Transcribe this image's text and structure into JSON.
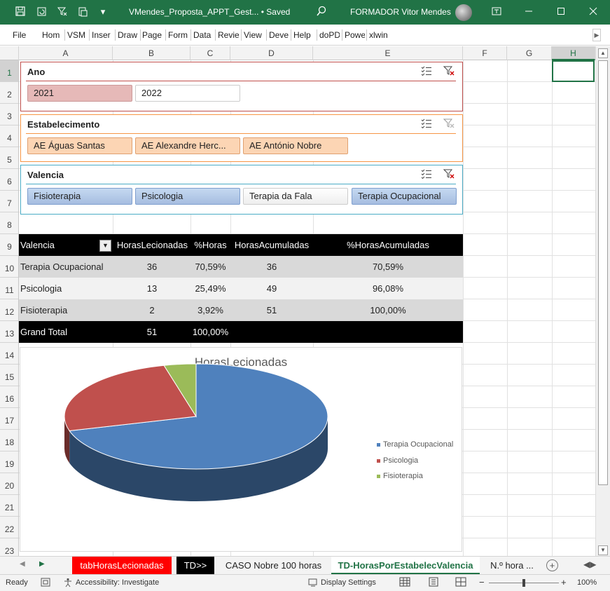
{
  "titlebar": {
    "doc_title": "VMendes_Proposta_APPT_Gest... • Saved",
    "user": "FORMADOR Vitor Mendes",
    "qat_more": "▾"
  },
  "ribbon": {
    "tabs": [
      "File",
      "Hom",
      "VSM",
      "Inser",
      "Draw",
      "Page",
      "Form",
      "Data",
      "Revie",
      "View",
      "Deve",
      "Help",
      "doPD",
      "Powe",
      "xlwin"
    ]
  },
  "columns": [
    "A",
    "B",
    "C",
    "D",
    "E",
    "F",
    "G",
    "H"
  ],
  "rows": [
    "1",
    "2",
    "3",
    "4",
    "5",
    "6",
    "7",
    "8",
    "9",
    "10",
    "11",
    "12",
    "13",
    "14",
    "15",
    "16",
    "17",
    "18",
    "19",
    "20",
    "21",
    "22",
    "23"
  ],
  "slicers": {
    "ano": {
      "title": "Ano",
      "items": [
        {
          "label": "2021",
          "selected": true
        },
        {
          "label": "2022",
          "selected": false
        }
      ]
    },
    "estabelecimento": {
      "title": "Estabelecimento",
      "items": [
        {
          "label": "AE Águas Santas",
          "selected": true
        },
        {
          "label": "AE Alexandre Herc...",
          "selected": true
        },
        {
          "label": "AE António Nobre",
          "selected": true
        }
      ]
    },
    "valencia": {
      "title": "Valencia",
      "items": [
        {
          "label": "Fisioterapia",
          "selected": true
        },
        {
          "label": "Psicologia",
          "selected": true
        },
        {
          "label": "Terapia da Fala",
          "selected": false
        },
        {
          "label": "Terapia Ocupacional",
          "selected": true
        }
      ]
    }
  },
  "pivot": {
    "headers": [
      "Valencia",
      "HorasLecionadas",
      "%Horas",
      "HorasAcumuladas",
      "%HorasAcumuladas"
    ],
    "rows": [
      [
        "Terapia Ocupacional",
        "36",
        "70,59%",
        "36",
        "70,59%"
      ],
      [
        "Psicologia",
        "13",
        "25,49%",
        "49",
        "96,08%"
      ],
      [
        "Fisioterapia",
        "2",
        "3,92%",
        "51",
        "100,00%"
      ]
    ],
    "total": [
      "Grand Total",
      "51",
      "100,00%",
      "",
      ""
    ]
  },
  "chart_data": {
    "type": "pie",
    "title": "HorasLecionadas",
    "categories": [
      "Terapia Ocupacional",
      "Psicologia",
      "Fisioterapia"
    ],
    "values": [
      36,
      13,
      2
    ],
    "colors": [
      "#4F81BD",
      "#C0504D",
      "#9BBB59"
    ],
    "legend": "right",
    "style": "3d"
  },
  "sheet_tabs": [
    {
      "label": "tabHorasLecionadas",
      "bg": "#FF0000",
      "color": "#ffffff"
    },
    {
      "label": "TD>>",
      "bg": "#000000",
      "color": "#ffffff"
    },
    {
      "label": "CASO Nobre 100 horas",
      "bg": "",
      "color": "#222222"
    },
    {
      "label": "TD-HorasPorEstabelecValencia",
      "bg": "",
      "color": "#217346"
    },
    {
      "label": "N.º hora ...",
      "bg": "",
      "color": "#222222"
    }
  ],
  "statusbar": {
    "ready": "Ready",
    "accessibility": "Accessibility: Investigate",
    "display_settings": "Display Settings",
    "zoom": "100%",
    "zoom_level": 1.0
  }
}
